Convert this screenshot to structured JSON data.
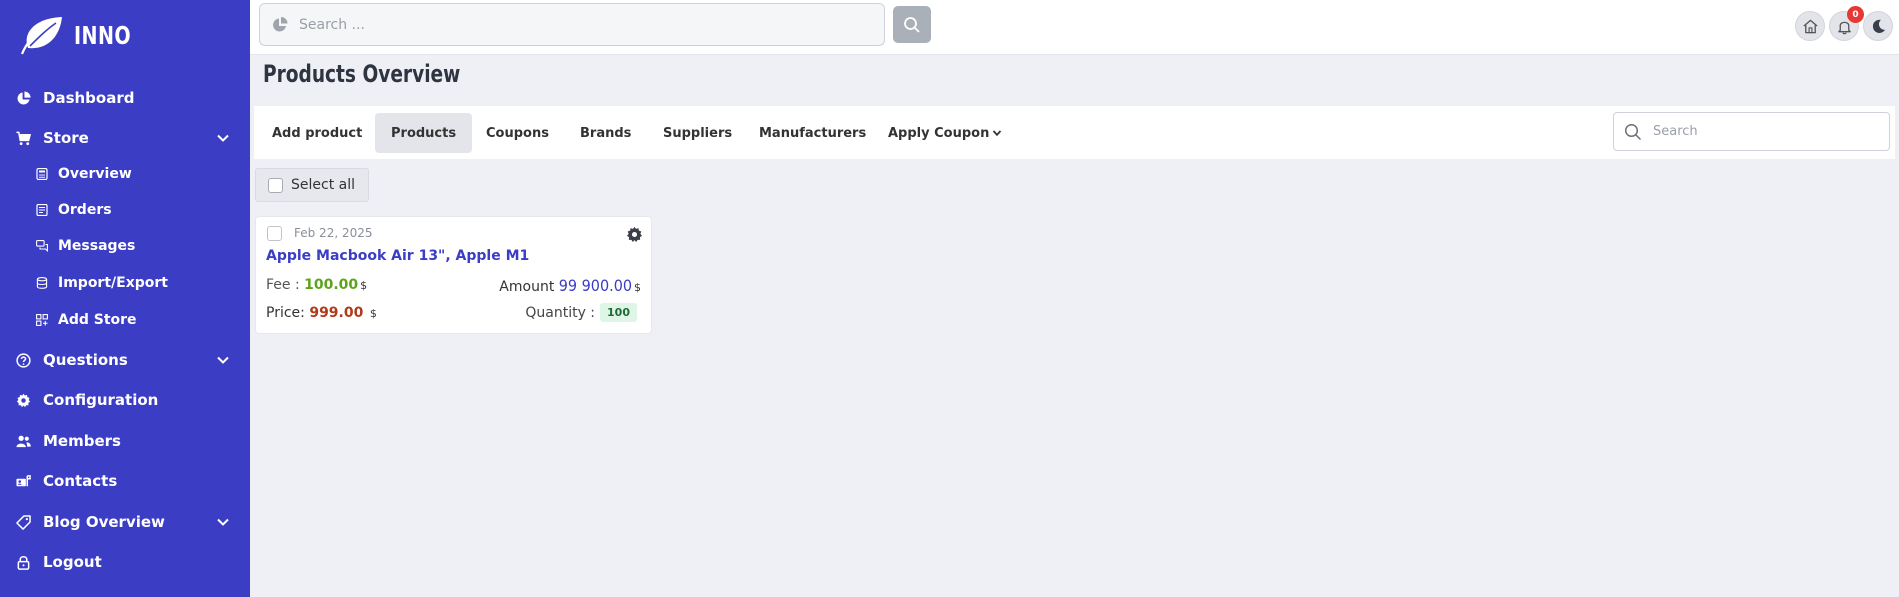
{
  "brand": {
    "name": "INNO"
  },
  "sidebar": {
    "items": [
      {
        "label": "Dashboard",
        "icon": "pie-chart-icon"
      },
      {
        "label": "Store",
        "icon": "cart-icon"
      },
      {
        "label": "Questions",
        "icon": "question-icon"
      },
      {
        "label": "Configuration",
        "icon": "gear-icon"
      },
      {
        "label": "Members",
        "icon": "users-icon"
      },
      {
        "label": "Contacts",
        "icon": "contacts-icon"
      },
      {
        "label": "Blog Overview",
        "icon": "tag-icon"
      },
      {
        "label": "Logout",
        "icon": "lock-icon"
      }
    ],
    "store_sub": [
      {
        "label": "Overview",
        "icon": "calculator-icon"
      },
      {
        "label": "Orders",
        "icon": "orders-icon"
      },
      {
        "label": "Messages",
        "icon": "messages-icon"
      },
      {
        "label": "Import/Export",
        "icon": "database-icon"
      },
      {
        "label": "Add Store",
        "icon": "grid-plus-icon"
      }
    ]
  },
  "topbar": {
    "search_placeholder": "Search ...",
    "notification_count": "0"
  },
  "page": {
    "title": "Products Overview"
  },
  "tabs": {
    "items": [
      "Add product",
      "Products",
      "Coupons",
      "Brands",
      "Suppliers",
      "Manufacturers",
      "Apply Coupon"
    ],
    "active": "Products",
    "search_placeholder": "Search"
  },
  "select_all": {
    "label": "Select all"
  },
  "product": {
    "date": "Feb 22, 2025",
    "title": "Apple Macbook Air 13\", Apple M1",
    "fee_label": "Fee :",
    "fee_value": "100.00",
    "currency": "$",
    "amount_label": "Amount",
    "amount_value": "99 900.00",
    "price_label": "Price:",
    "price_value": "999.00",
    "quantity_label": "Quantity :",
    "quantity_value": "100"
  },
  "colors": {
    "sidebar_bg": "#3b3dc4",
    "fee": "#5aa51a",
    "price": "#b03a1a",
    "accent": "#3b3dc4"
  }
}
